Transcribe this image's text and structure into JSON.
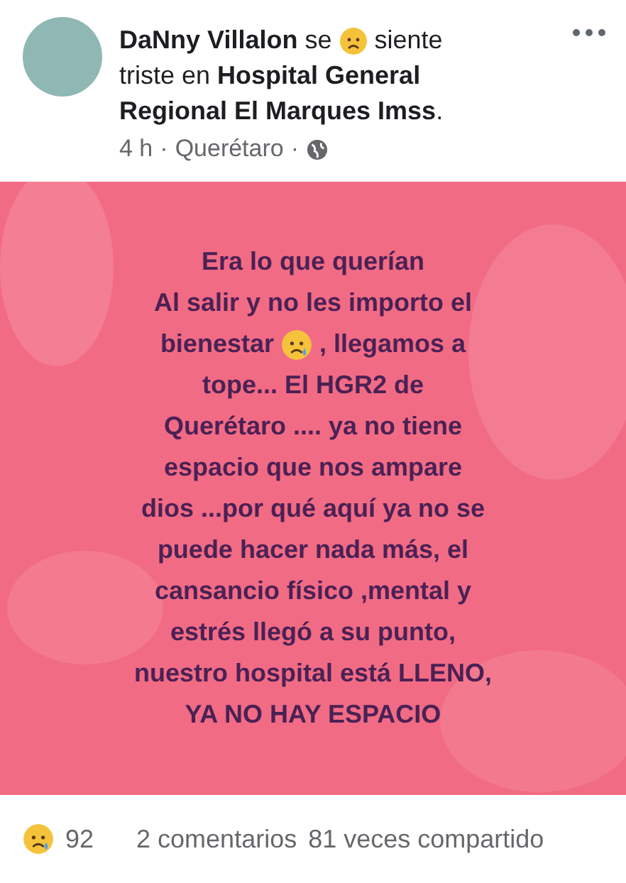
{
  "post": {
    "header_lines": [
      {
        "kind": "emoji",
        "text": "**DaNny Villalon** se",
        "after": "siente"
      },
      {
        "kind": "plain",
        "text": "triste en **Hospital General**"
      },
      {
        "kind": "plain",
        "text": "**Regional El Marques Imss**."
      }
    ],
    "time": "4 h",
    "sep1": "·",
    "place": "Querétaro",
    "sep2": "·"
  },
  "image": {
    "lines": [
      {
        "kind": "plain",
        "text": "Era lo que querían"
      },
      {
        "kind": "plain",
        "text": "Al salir y no les importo el"
      },
      {
        "kind": "emoji",
        "text": "bienestar",
        "after": ", llegamos a"
      },
      {
        "kind": "plain",
        "text": "tope... El HGR2  de"
      },
      {
        "kind": "plain",
        "text": "Querétaro .... ya no tiene"
      },
      {
        "kind": "plain",
        "text": "espacio que nos ampare"
      },
      {
        "kind": "plain",
        "text": "dios ...por qué aquí ya no se"
      },
      {
        "kind": "plain",
        "text": "puede hacer nada más, el"
      },
      {
        "kind": "plain",
        "text": "cansancio físico ,mental y"
      },
      {
        "kind": "plain",
        "text": "estrés llegó a su punto,"
      },
      {
        "kind": "plain",
        "text": "nuestro hospital está LLENO,"
      },
      {
        "kind": "plain",
        "text": "YA NO HAY ESPACIO"
      }
    ]
  },
  "footer": {
    "reactions": "92",
    "comments": "2 comentarios",
    "shares": "81 veces compartido"
  }
}
